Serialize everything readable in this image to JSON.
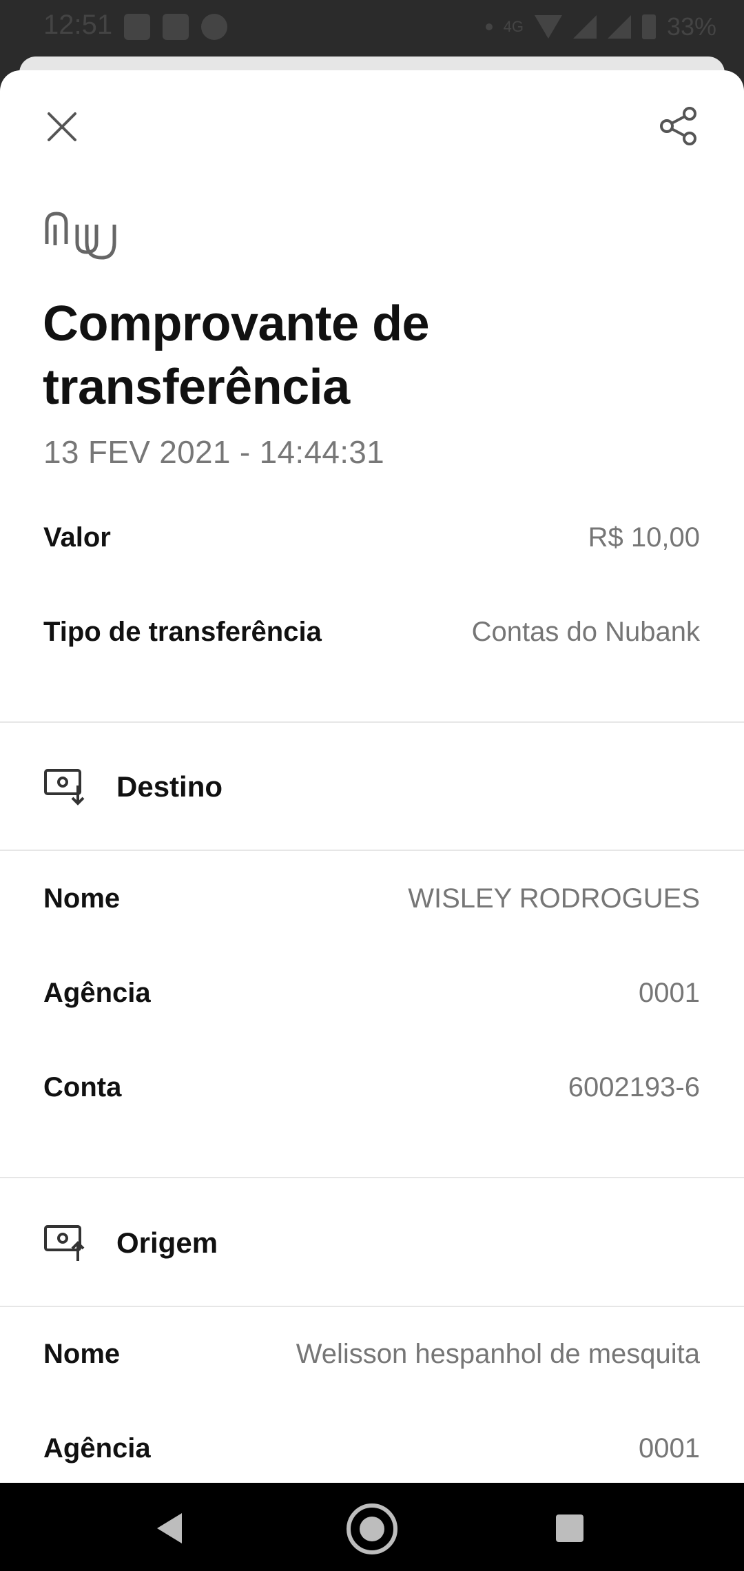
{
  "status_bar": {
    "time": "12:51",
    "network": "4G",
    "battery": "33%"
  },
  "header": {
    "close_icon": "close-icon",
    "share_icon": "share-icon"
  },
  "brand": {
    "logo": "nu-logo"
  },
  "receipt": {
    "title": "Comprovante de transferência",
    "datetime": "13 FEV 2021 - 14:44:31",
    "amount_label": "Valor",
    "amount_value": "R$ 10,00",
    "type_label": "Tipo de transferência",
    "type_value": "Contas do Nubank"
  },
  "destination": {
    "section_title": "Destino",
    "icon": "receive-money-icon",
    "name_label": "Nome",
    "name_value": "WISLEY RODROGUES",
    "agency_label": "Agência",
    "agency_value": "0001",
    "account_label": "Conta",
    "account_value": "6002193-6"
  },
  "origin": {
    "section_title": "Origem",
    "icon": "send-money-icon",
    "name_label": "Nome",
    "name_value": "Welisson hespanhol de mesquita",
    "agency_label": "Agência",
    "agency_value": "0001"
  },
  "colors": {
    "title": "#111111",
    "muted": "#767676",
    "divider": "#e6e6e6",
    "nav_bar": "#000000"
  }
}
